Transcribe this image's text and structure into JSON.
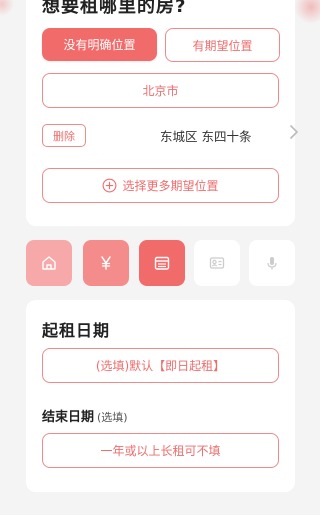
{
  "location": {
    "heading": "想要租哪里的房?",
    "no_specific_button": "没有明确位置",
    "has_expected_button": "有期望位置",
    "city": "北京市",
    "delete_button": "删除",
    "district": "东城区 东四十条",
    "add_more_button": "选择更多期望位置"
  },
  "steps": [
    {
      "icon": "home-icon",
      "state": "done-light"
    },
    {
      "icon": "yen-icon",
      "state": "done"
    },
    {
      "icon": "calendar-icon",
      "state": "active"
    },
    {
      "icon": "id-card-icon",
      "state": "inactive"
    },
    {
      "icon": "microphone-icon",
      "state": "inactive"
    }
  ],
  "dates": {
    "start_heading": "起租日期",
    "start_value": "(选填)默认【即日起租】",
    "end_heading": "结束日期",
    "end_optional": "(选填)",
    "end_value": "一年或以上长租可不填"
  },
  "colors": {
    "accent": "#f26b6b",
    "accent_outline": "#f08a8a",
    "step_done_light": "#f7a8a8",
    "step_done": "#f58c8c",
    "background": "#f4f4f4"
  }
}
